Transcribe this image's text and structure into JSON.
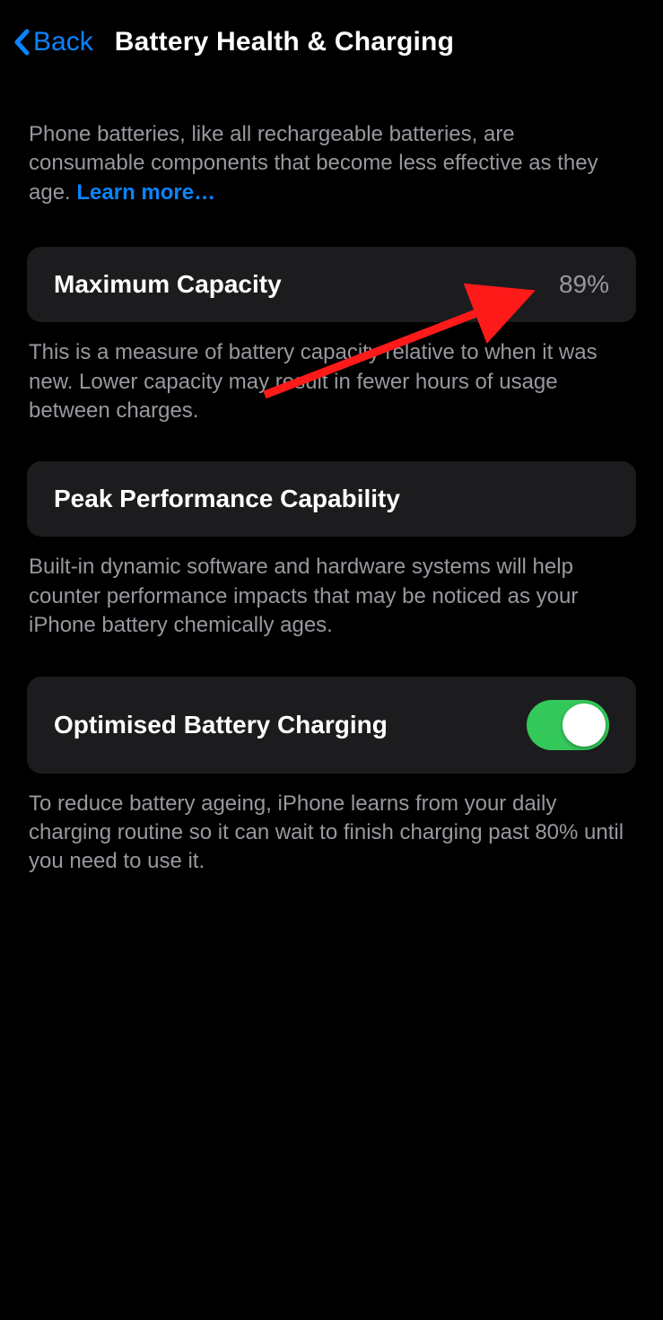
{
  "header": {
    "back_label": "Back",
    "title": "Battery Health & Charging"
  },
  "intro": {
    "text": "Phone batteries, like all rechargeable batteries, are consumable components that become less effective as they age. ",
    "learn_more": "Learn more…"
  },
  "maximum_capacity": {
    "label": "Maximum Capacity",
    "value": "89%",
    "description": "This is a measure of battery capacity relative to when it was new. Lower capacity may result in fewer hours of usage between charges."
  },
  "peak_performance": {
    "label": "Peak Performance Capability",
    "description": "Built-in dynamic software and hardware systems will help counter performance impacts that may be noticed as your iPhone battery chemically ages."
  },
  "optimised_charging": {
    "label": "Optimised Battery Charging",
    "enabled": true,
    "description": "To reduce battery ageing, iPhone learns from your daily charging routine so it can wait to finish charging past 80% until you need to use it."
  }
}
